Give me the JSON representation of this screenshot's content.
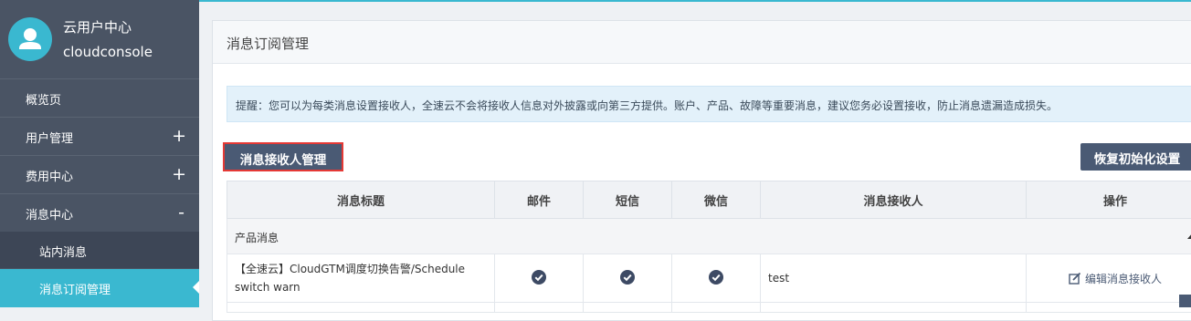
{
  "sidebar": {
    "profile": {
      "name": "云用户中心",
      "sub": "cloudconsole"
    },
    "items": [
      {
        "label": "概览页",
        "sign": ""
      },
      {
        "label": "用户管理",
        "sign": "+"
      },
      {
        "label": "费用中心",
        "sign": "+"
      },
      {
        "label": "消息中心",
        "sign": "-"
      }
    ],
    "subitems": [
      {
        "label": "站内消息"
      },
      {
        "label": "消息订阅管理"
      }
    ]
  },
  "main": {
    "title": "消息订阅管理",
    "notice": "提醒：您可以为每类消息设置接收人，全速云不会将接收人信息对外披露或向第三方提供。账户、产品、故障等重要消息，建议您务必设置接收，防止消息遗漏造成损失。",
    "buttons": {
      "receiver_manage": "消息接收人管理",
      "reset": "恢复初始化设置"
    },
    "table": {
      "headers": [
        "消息标题",
        "邮件",
        "短信",
        "微信",
        "消息接收人",
        "操作"
      ],
      "group": "产品消息",
      "rows": [
        {
          "title": "【全速云】CloudGTM调度切换告警/Schedule switch warn",
          "email": true,
          "sms": true,
          "wechat": true,
          "receiver": "test",
          "action": "编辑消息接收人"
        }
      ]
    }
  },
  "colors": {
    "accent": "#3ab8d0",
    "sidebar": "#4a5464",
    "button": "#4a5a74",
    "highlight_border": "#e53935"
  }
}
